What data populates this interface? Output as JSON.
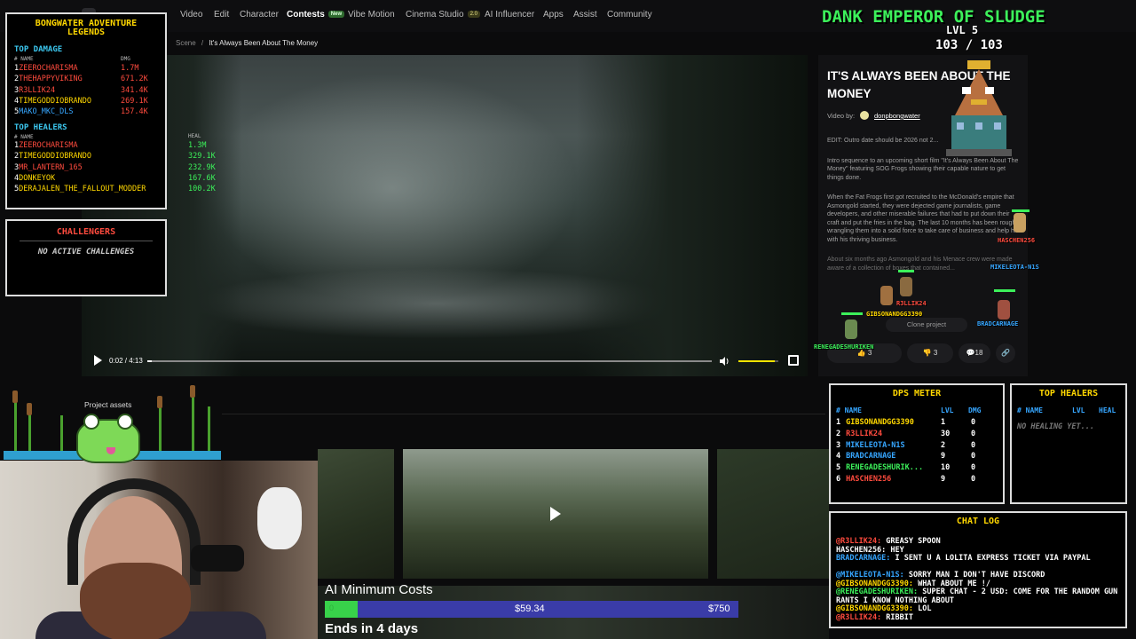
{
  "nav": {
    "items": [
      {
        "label": "Video",
        "active": false
      },
      {
        "label": "Edit",
        "active": false
      },
      {
        "label": "Character",
        "active": false
      },
      {
        "label": "Contests",
        "active": true,
        "badge": "New"
      },
      {
        "label": "Vibe Motion",
        "active": false
      },
      {
        "label": "Cinema Studio",
        "active": false,
        "badge": "2.0"
      },
      {
        "label": "AI Influencer",
        "active": false
      },
      {
        "label": "Apps",
        "active": false
      },
      {
        "label": "Assist",
        "active": false
      },
      {
        "label": "Community",
        "active": false
      }
    ]
  },
  "breadcrumb": {
    "parent": "Scene",
    "separator": "/",
    "current": "It's Always Been About The Money"
  },
  "player": {
    "time": "0:02 / 4:13",
    "progress": 0.008,
    "volume": 0.9
  },
  "info": {
    "title": "IT'S ALWAYS BEEN ABOUT THE MONEY",
    "video_by_label": "Video by:",
    "author": "donpbongwater",
    "desc": [
      "EDIT: Outro date should be 2026 not 2...",
      "Intro sequence to an upcoming short film \"It's Always Been About The Money\" featuring SOG Frogs showing their capable nature to get things done.",
      "When the Fat Frogs first got recruited to the McDonald's empire that Asmongold started, they were dejected game journalists, game developers, and other miserable failures that had to put down their craft and put the fries in the bag. The last 10 months has been rough in wrangling them into a solid force to take care of business and help him with his thriving business.",
      "About six months ago Asmongold and his Menace crew were made aware of a collection of boxes that contained..."
    ],
    "clone_label": "Clone project",
    "likes": "3",
    "dislikes": "3",
    "comments": "18"
  },
  "assets_label": "Project assets",
  "costs": {
    "title": "AI Minimum Costs",
    "min": "0",
    "current": "$59.34",
    "goal": "$750",
    "fraction": 0.079,
    "ends": "Ends in 4 days"
  },
  "legends": {
    "title_line1": "BONGWATER ADVENTURE",
    "title_line2": "LEGENDS",
    "damage_title": "TOP DAMAGE",
    "damage_cols": [
      "# NAME",
      "DMG"
    ],
    "damage": [
      {
        "rank": "1",
        "name": "ZEEROCHARISMA",
        "val": "1.7M",
        "color": "#ff4b3e"
      },
      {
        "rank": "2",
        "name": "THEHAPPYVIKING",
        "val": "671.2K",
        "color": "#ff4b3e"
      },
      {
        "rank": "3",
        "name": "R3LLIK24",
        "val": "341.4K",
        "color": "#ff4b3e"
      },
      {
        "rank": "4",
        "name": "TIMEGODDIOBRANDO",
        "val": "269.1K",
        "color": "#ffd700"
      },
      {
        "rank": "5",
        "name": "MAKO_MKC_DLS",
        "val": "157.4K",
        "color": "#36a6ff"
      }
    ],
    "heal_title": "TOP HEALERS",
    "heal_cols": [
      "# NAME",
      "HEAL"
    ],
    "heal": [
      {
        "rank": "1",
        "name": "ZEEROCHARISMA",
        "val": "1.3M",
        "color": "#ff4b3e"
      },
      {
        "rank": "2",
        "name": "TIMEGODDIOBRANDO",
        "val": "329.1K",
        "color": "#ffd700"
      },
      {
        "rank": "3",
        "name": "MR_LANTERN_165",
        "val": "232.9K",
        "color": "#ff4b3e"
      },
      {
        "rank": "4",
        "name": "DONKEYOK",
        "val": "167.6K",
        "color": "#ffd700"
      },
      {
        "rank": "5",
        "name": "DERAJALEN_THE_FALLOUT_MODDER",
        "val": "100.2K",
        "color": "#ffd700"
      }
    ]
  },
  "challengers": {
    "title": "CHALLENGERS",
    "empty": "NO ACTIVE CHALLENGES"
  },
  "boss": {
    "name": "DANK EMPEROR OF SLUDGE",
    "level": "LVL 5",
    "hp": "103 / 103"
  },
  "units": [
    {
      "name": "MIKELEOTA-N1S"
    },
    {
      "name": "HASCHEN256"
    },
    {
      "name": "R3LLIK24"
    },
    {
      "name": "GIBSONANDGG3390"
    },
    {
      "name": "BRADCARNAGE"
    },
    {
      "name": "RENEGADESHURIKEN"
    }
  ],
  "dps": {
    "title": "DPS METER",
    "cols": [
      "# NAME",
      "LVL",
      "DMG"
    ],
    "rows": [
      {
        "rank": "1",
        "name": "GIBSONANDGG3390",
        "lvl": "1",
        "dmg": "0",
        "color": "#ffd700"
      },
      {
        "rank": "2",
        "name": "R3LLIK24",
        "lvl": "30",
        "dmg": "0",
        "color": "#ff4b3e"
      },
      {
        "rank": "3",
        "name": "MIKELEOTA-N1S",
        "lvl": "2",
        "dmg": "0",
        "color": "#36a6ff"
      },
      {
        "rank": "4",
        "name": "BRADCARNAGE",
        "lvl": "9",
        "dmg": "0",
        "color": "#36a6ff"
      },
      {
        "rank": "5",
        "name": "RENEGADESHURIK...",
        "lvl": "10",
        "dmg": "0",
        "color": "#3cf05a"
      },
      {
        "rank": "6",
        "name": "HASCHEN256",
        "lvl": "9",
        "dmg": "0",
        "color": "#ff4b3e"
      }
    ]
  },
  "healers": {
    "title": "TOP HEALERS",
    "cols": [
      "# NAME",
      "LVL",
      "HEAL"
    ],
    "empty": "NO HEALING YET..."
  },
  "chat": {
    "title": "CHAT LOG",
    "lines": [
      {
        "user": "@R3LLIK24:",
        "msg": " GREASY SPOON",
        "color": "#ff4b3e"
      },
      {
        "user": "HASCHEN256:",
        "msg": " HEY",
        "color": "#ffffff"
      },
      {
        "user": "BRADCARNAGE:",
        "msg": " I SENT U A LOLITA EXPRESS TICKET VIA PAYPAL",
        "color": "#36a6ff"
      },
      {
        "user": "@MIKELEOTA-N1S:",
        "msg": " SORRY MAN I DON'T HAVE DISCORD",
        "color": "#36a6ff"
      },
      {
        "user": "@GIBSONANDGG3390:",
        "msg": " WHAT ABOUT ME !/",
        "color": "#ffd700"
      },
      {
        "user": "@RENEGADESHURIKEN:",
        "msg": " SUPER CHAT - 2 USD: COME FOR THE RANDOM GUN RANTS I KNOW NOTHING ABOUT",
        "color": "#3cf05a"
      },
      {
        "user": "@GIBSONANDGG3390:",
        "msg": " LOL",
        "color": "#ffd700"
      },
      {
        "user": "@R3LLIK24:",
        "msg": " RIBBIT",
        "color": "#ff4b3e"
      }
    ]
  }
}
